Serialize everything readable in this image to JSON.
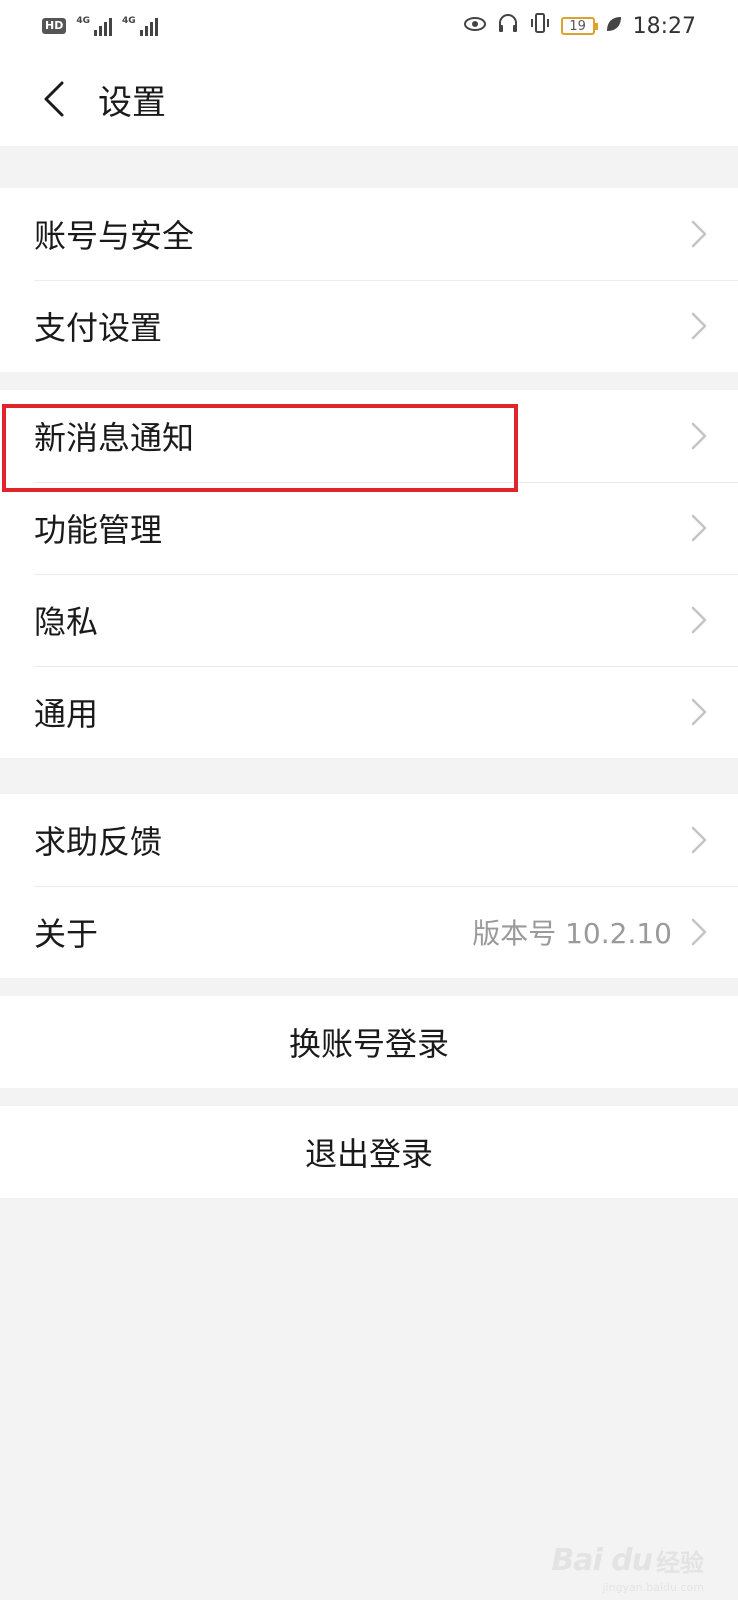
{
  "status_bar": {
    "hd": "HD",
    "sim1_tag": "4G",
    "sim2_tag": "4G",
    "battery_level": "19",
    "time": "18:27",
    "icons": [
      "eye-icon",
      "headphones-icon",
      "vibrate-icon",
      "leaf-icon"
    ]
  },
  "header": {
    "title": "设置"
  },
  "groups": [
    {
      "items": [
        {
          "label": "账号与安全"
        },
        {
          "label": "支付设置"
        }
      ]
    },
    {
      "items": [
        {
          "label": "新消息通知"
        },
        {
          "label": "功能管理"
        },
        {
          "label": "隐私"
        },
        {
          "label": "通用"
        }
      ]
    },
    {
      "items": [
        {
          "label": "求助反馈"
        },
        {
          "label": "关于",
          "value": "版本号 10.2.10"
        }
      ]
    }
  ],
  "actions": {
    "switch_account": "换账号登录",
    "logout": "退出登录"
  },
  "watermark": {
    "logo": "Bai du",
    "cn": "经验",
    "url": "jingyan.baidu.com"
  },
  "colors": {
    "highlight": "#e0242b",
    "background": "#f3f3f3",
    "card": "#ffffff"
  }
}
